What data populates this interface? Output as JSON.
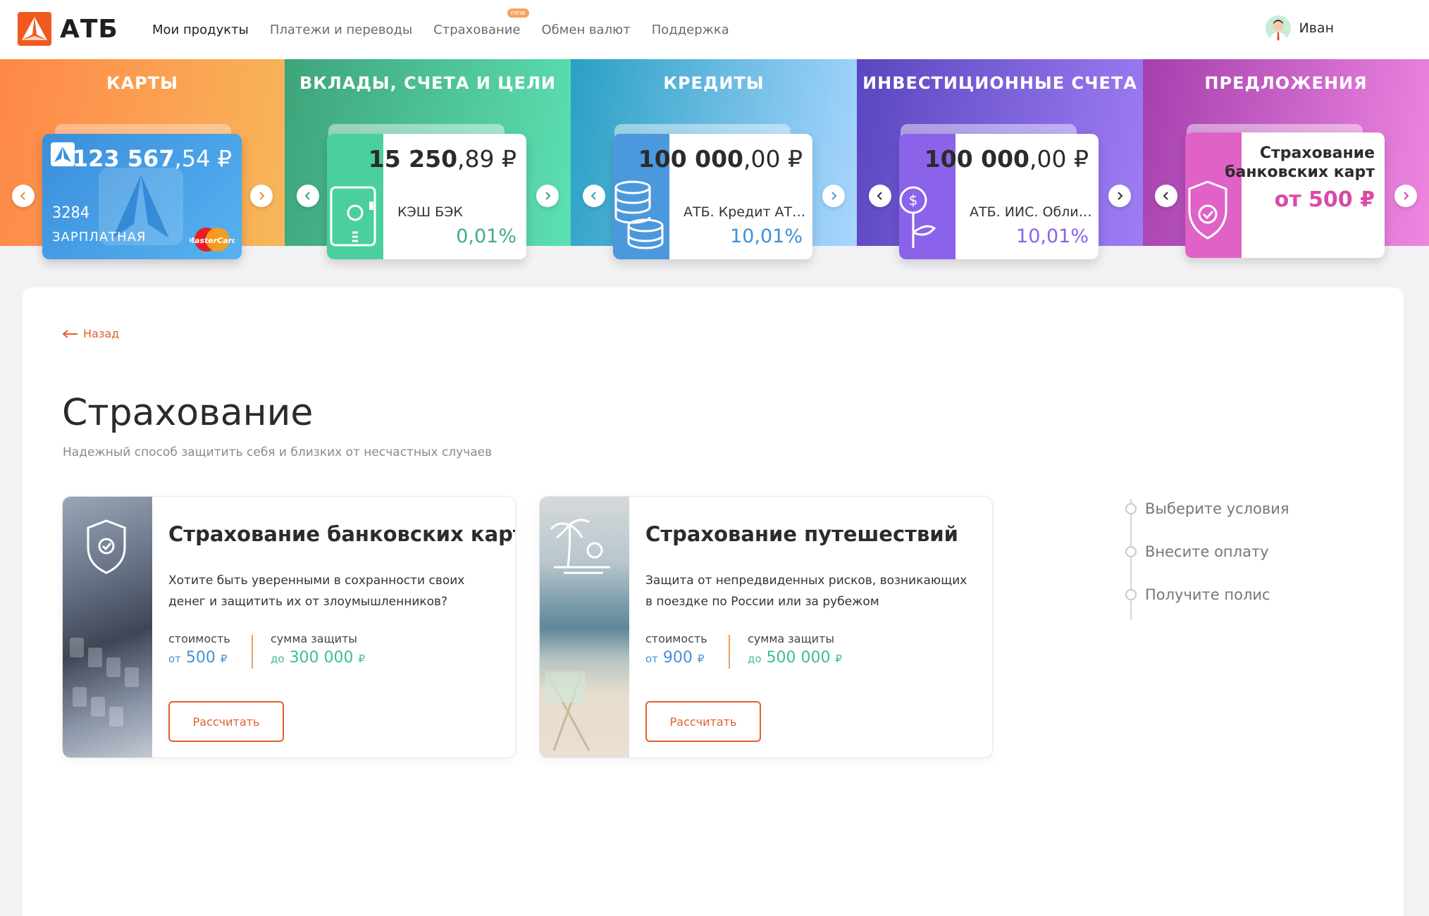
{
  "brand": {
    "name": "АТБ",
    "accent": "#f05a1e"
  },
  "nav": {
    "items": [
      {
        "label": "Мои продукты",
        "active": true
      },
      {
        "label": "Платежи и переводы"
      },
      {
        "label": "Страхование",
        "badge": "new"
      },
      {
        "label": "Обмен валют"
      },
      {
        "label": "Поддержка"
      }
    ]
  },
  "user": {
    "name": "Иван",
    "icon": "user-avatar"
  },
  "strip": {
    "cards": {
      "title": "КАРТЫ",
      "amount_main": "123 567",
      "amount_frac": ",54 ₽",
      "number": "3284",
      "name": "ЗАРПЛАТНАЯ",
      "payment_system": "MasterCard"
    },
    "deposits": {
      "title": "ВКЛАДЫ, СЧЕТА И ЦЕЛИ",
      "amount_main": "15 250",
      "amount_frac": ",89 ₽",
      "label": "КЭШ БЭК",
      "rate": "0,01%",
      "icon": "safe-icon",
      "color": "#4bcf9c"
    },
    "credits": {
      "title": "КРЕДИТЫ",
      "amount_main": "100 000",
      "amount_frac": ",00 ₽",
      "label": "АТБ. Кредит АТБ…",
      "rate": "10,01%",
      "icon": "coins-icon",
      "color": "#4c98dc"
    },
    "investments": {
      "title": "ИНВЕСТИЦИОННЫЕ СЧЕТА",
      "amount_main": "100 000",
      "amount_frac": ",00 ₽",
      "label": "АТБ. ИИС. Обли…",
      "rate": "10,01%",
      "icon": "money-plant-icon",
      "color": "#8a63ea"
    },
    "offers": {
      "title": "ПРЕДЛОЖЕНИЯ",
      "offer_line1": "Страхование",
      "offer_line2": "банковских карт",
      "offer_price": "от 500 ₽",
      "icon": "shield-check-icon",
      "color": "#e062c6"
    }
  },
  "page": {
    "back": "Назад",
    "title": "Страхование",
    "subtitle": "Надежный способ защитить себя и близких от несчастных случаев"
  },
  "insurance": [
    {
      "title": "Страхование банковских карт",
      "description": "Хотите быть уверенными в сохранности своих денег и защитить их от злоумышленников?",
      "cost_label": "стоимость",
      "cost_prefix": "от",
      "cost_value": "500",
      "sum_label": "сумма защиты",
      "sum_prefix": "до",
      "sum_value": "300 000",
      "currency": "₽",
      "button": "Рассчитать",
      "icon": "shield-check-icon"
    },
    {
      "title": "Страхование путешествий",
      "description": "Защита от непредвиденных рисков, возникающих в поездке по России или за рубежом",
      "cost_label": "стоимость",
      "cost_prefix": "от",
      "cost_value": "900",
      "sum_label": "сумма защиты",
      "sum_prefix": "до",
      "sum_value": "500 000",
      "currency": "₽",
      "button": "Рассчитать",
      "icon": "palm-sun-icon"
    }
  ],
  "steps": [
    "Выберите условия",
    "Внесите оплату",
    "Получите полис"
  ]
}
